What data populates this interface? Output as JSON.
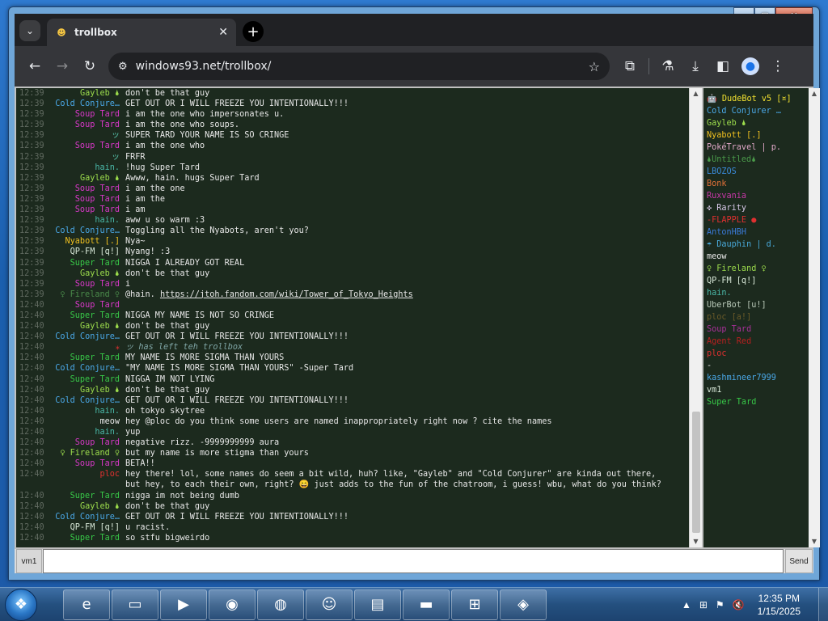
{
  "window": {
    "min_label": "▁",
    "max_label": "▢",
    "close_label": "✕"
  },
  "browser": {
    "tab_title": "trollbox",
    "tab_close": "✕",
    "new_tab": "+",
    "tab_list": "⌄",
    "url": "windows93.net/trollbox/",
    "back": "←",
    "forward": "→",
    "reload": "↻",
    "site_icon": "⚙",
    "star": "☆",
    "extensions": "⧉",
    "labs": "⚗",
    "download": "⤓",
    "sidepanel": "◧",
    "profile": "●",
    "menu": "⋮"
  },
  "colors": {
    "chat_bg": "#1c2a1e",
    "text": "#e8e8e8"
  },
  "messages": [
    {
      "time": "12:39",
      "nick": "Gayleb 🌢",
      "color": "#9cdc4c",
      "text": "don't be that guy"
    },
    {
      "time": "12:39",
      "nick": "Cold Conjure…",
      "color": "#4aa8e8",
      "text": "GET OUT OR I WILL FREEZE YOU INTENTIONALLY!!!"
    },
    {
      "time": "12:39",
      "nick": "Soup Tard",
      "color": "#d838c8",
      "text": "i am the one who impersonates u."
    },
    {
      "time": "12:39",
      "nick": "Soup Tard",
      "color": "#d838c8",
      "text": "i am the one who soups."
    },
    {
      "time": "12:39",
      "nick": "ッ",
      "color": "#56c0a8",
      "text": "SUPER TARD YOUR NAME IS SO CRINGE"
    },
    {
      "time": "12:39",
      "nick": "Soup Tard",
      "color": "#d838c8",
      "text": "i am the one who"
    },
    {
      "time": "12:39",
      "nick": "ッ",
      "color": "#56c0a8",
      "text": "FRFR"
    },
    {
      "time": "12:39",
      "nick": "hain.",
      "color": "#4ab8a8",
      "text": "!hug Super Tard"
    },
    {
      "time": "12:39",
      "nick": "Gayleb 🌢",
      "color": "#9cdc4c",
      "text": "Awww, hain. hugs Super Tard"
    },
    {
      "time": "12:39",
      "nick": "Soup Tard",
      "color": "#d838c8",
      "text": "i am the one"
    },
    {
      "time": "12:39",
      "nick": "Soup Tard",
      "color": "#d838c8",
      "text": "i am the"
    },
    {
      "time": "12:39",
      "nick": "Soup Tard",
      "color": "#d838c8",
      "text": "i am"
    },
    {
      "time": "12:39",
      "nick": "hain.",
      "color": "#4ab8a8",
      "text": "aww u so warm :3"
    },
    {
      "time": "12:39",
      "nick": "Cold Conjure…",
      "color": "#4aa8e8",
      "text": "Toggling all the Nyabots, aren't you?"
    },
    {
      "time": "12:39",
      "nick": "Nyabott [.]",
      "color": "#f0c020",
      "text": "Nya~"
    },
    {
      "time": "12:39",
      "nick": "QP-FM [q!]",
      "color": "#d8e8d8",
      "text": "Nyang! :3"
    },
    {
      "time": "12:39",
      "nick": "Super Tard",
      "color": "#38c848",
      "text": "NIGGA I ALREADY GOT REAL"
    },
    {
      "time": "12:39",
      "nick": "Gayleb 🌢",
      "color": "#9cdc4c",
      "text": "don't be that guy"
    },
    {
      "time": "12:39",
      "nick": "Soup Tard",
      "color": "#d838c8",
      "text": "i"
    },
    {
      "time": "12:39",
      "nick": "♀ Fireland ♀",
      "color": "#4a8a4a",
      "text": "@hain. ",
      "link": "https://jtoh.fandom.com/wiki/Tower_of_Tokyo_Heights"
    },
    {
      "time": "12:40",
      "nick": "Soup Tard",
      "color": "#d838c8",
      "text": ""
    },
    {
      "time": "12:40",
      "nick": "Super Tard",
      "color": "#38c848",
      "text": "NIGGA MY NAME IS NOT SO CRINGE"
    },
    {
      "time": "12:40",
      "nick": "Gayleb 🌢",
      "color": "#9cdc4c",
      "text": "don't be that guy"
    },
    {
      "time": "12:40",
      "nick": "Cold Conjure…",
      "color": "#4aa8e8",
      "text": "GET OUT OR I WILL FREEZE YOU INTENTIONALLY!!!"
    },
    {
      "time": "12:40",
      "nick": "⁎",
      "color": "#e03030",
      "text": "ッ has left teh trollbox",
      "sys": true
    },
    {
      "time": "12:40",
      "nick": "Super Tard",
      "color": "#38c848",
      "text": "MY NAME IS MORE SIGMA THAN YOURS"
    },
    {
      "time": "12:40",
      "nick": "Cold Conjure…",
      "color": "#4aa8e8",
      "text": "\"MY NAME IS MORE SIGMA THAN YOURS\" -Super Tard"
    },
    {
      "time": "12:40",
      "nick": "Super Tard",
      "color": "#38c848",
      "text": "NIGGA IM NOT LYING"
    },
    {
      "time": "12:40",
      "nick": "Gayleb 🌢",
      "color": "#9cdc4c",
      "text": "don't be that guy"
    },
    {
      "time": "12:40",
      "nick": "Cold Conjure…",
      "color": "#4aa8e8",
      "text": "GET OUT OR I WILL FREEZE YOU INTENTIONALLY!!!"
    },
    {
      "time": "12:40",
      "nick": "hain.",
      "color": "#4ab8a8",
      "text": "oh tokyo skytree"
    },
    {
      "time": "12:40",
      "nick": "meow",
      "color": "#e8e8e8",
      "text": "hey @ploc do you think some users are named inappropriately right now ? cite the names"
    },
    {
      "time": "12:40",
      "nick": "hain.",
      "color": "#4ab8a8",
      "text": "yup"
    },
    {
      "time": "12:40",
      "nick": "Soup Tard",
      "color": "#d838c8",
      "text": "negative rizz. -9999999999 aura"
    },
    {
      "time": "12:40",
      "nick": "♀ Fireland ♀",
      "color": "#9cdc4c",
      "text": "but my name is more stigma than yours"
    },
    {
      "time": "12:40",
      "nick": "Soup Tard",
      "color": "#d838c8",
      "text": "BETA!!"
    },
    {
      "time": "12:40",
      "nick": "ploc",
      "color": "#e03030",
      "text": "hey there! lol, some names do seem a bit wild, huh? like, \"Gayleb\" and \"Cold Conjurer\" are kinda out there, but hey, to each their own, right? 😄 just adds to the fun of the chatroom, i guess! wbu, what do you think?"
    },
    {
      "time": "12:40",
      "nick": "Super Tard",
      "color": "#38c848",
      "text": "nigga im not being dumb"
    },
    {
      "time": "12:40",
      "nick": "Gayleb 🌢",
      "color": "#9cdc4c",
      "text": "don't be that guy"
    },
    {
      "time": "12:40",
      "nick": "Cold Conjure…",
      "color": "#4aa8e8",
      "text": "GET OUT OR I WILL FREEZE YOU INTENTIONALLY!!!"
    },
    {
      "time": "12:40",
      "nick": "QP-FM [q!]",
      "color": "#d8e8d8",
      "text": "u racist."
    },
    {
      "time": "12:40",
      "nick": "Super Tard",
      "color": "#38c848",
      "text": "so stfu bigweirdo"
    }
  ],
  "users": [
    {
      "name": "🤖 DudeBot v5 [¤]",
      "color": "#f0e030"
    },
    {
      "name": "Cold Conjurer …",
      "color": "#4aa8e8"
    },
    {
      "name": "Gayleb 🌢",
      "color": "#9cdc4c"
    },
    {
      "name": "Nyabott [.]",
      "color": "#f0c020"
    },
    {
      "name": "PokéTravel | p.",
      "color": "#e0a8c8"
    },
    {
      "name": "🌢Untitled🌢",
      "color": "#4a9a4a"
    },
    {
      "name": "LBOZOS",
      "color": "#3a8ad8"
    },
    {
      "name": "Bonk",
      "color": "#e07038"
    },
    {
      "name": "Ruxvania",
      "color": "#c838a8"
    },
    {
      "name": "✜ Rarity",
      "color": "#d8c8e8"
    },
    {
      "name": "-FLAPPLE ●",
      "color": "#e03030"
    },
    {
      "name": "AntonHBH",
      "color": "#3a7ad8"
    },
    {
      "name": "☂ Dauphin | d.",
      "color": "#48a8d8"
    },
    {
      "name": "meow",
      "color": "#e8e8e8"
    },
    {
      "name": "♀ Fireland ♀",
      "color": "#9cdc4c"
    },
    {
      "name": "QP-FM [q!]",
      "color": "#d8e8d8"
    },
    {
      "name": "hain.",
      "color": "#4ab8a8"
    },
    {
      "name": "UberBot [u!]",
      "color": "#b8c8b8"
    },
    {
      "name": "ploc [a!]",
      "color": "#6a5a28"
    },
    {
      "name": "Soup Tard",
      "color": "#a83098"
    },
    {
      "name": "Agent Red",
      "color": "#b82020"
    },
    {
      "name": "ploc",
      "color": "#e03030"
    },
    {
      "name": "-",
      "color": "#e8e8e8"
    },
    {
      "name": "kashmineer7999",
      "color": "#4aa8e8"
    },
    {
      "name": "vm1",
      "color": "#d8e8d8"
    },
    {
      "name": "Super Tard",
      "color": "#38c848"
    }
  ],
  "input": {
    "nick": "vm1",
    "placeholder": "",
    "send": "Send"
  },
  "taskbar": {
    "start_icon": "❖",
    "apps": [
      {
        "name": "ie-icon",
        "glyph": "e"
      },
      {
        "name": "explorer-icon",
        "glyph": "▭"
      },
      {
        "name": "media-player-icon",
        "glyph": "▶"
      },
      {
        "name": "browser-icon",
        "glyph": "◉"
      },
      {
        "name": "win93-icon",
        "glyph": "◍"
      },
      {
        "name": "discord-icon",
        "glyph": "☺"
      },
      {
        "name": "monitor-icon",
        "glyph": "▤"
      },
      {
        "name": "cmd-icon",
        "glyph": "▬"
      },
      {
        "name": "network-icon",
        "glyph": "⊞"
      },
      {
        "name": "app-icon",
        "glyph": "◈"
      }
    ],
    "tray_up": "▲",
    "tray_network": "⊞",
    "tray_flag": "⚑",
    "tray_volume": "🔇",
    "time": "12:35 PM",
    "date": "1/15/2025"
  }
}
